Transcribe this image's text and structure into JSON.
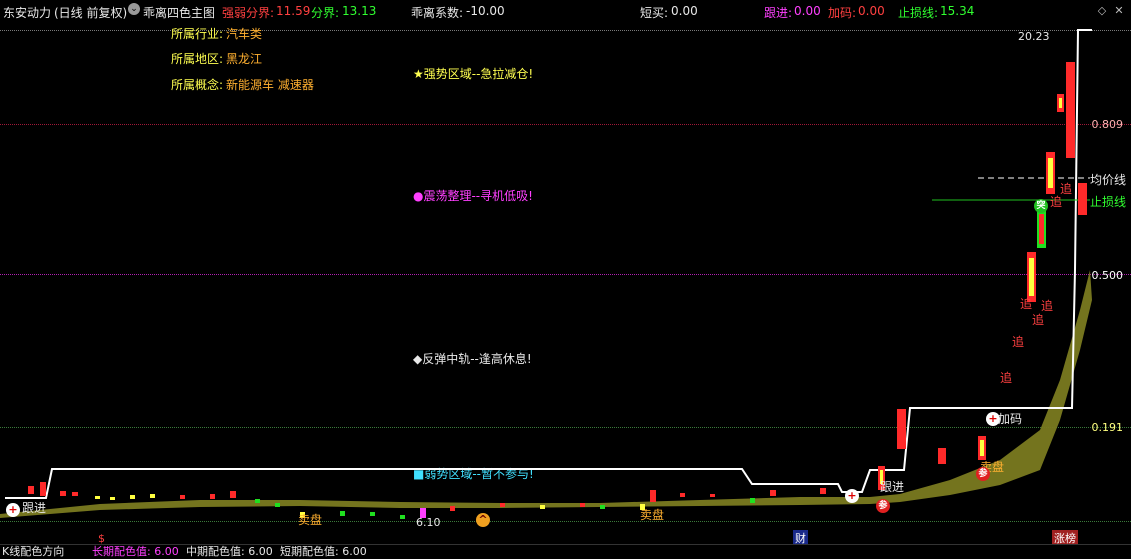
{
  "header": {
    "stock_name": "东安动力",
    "period": "(日线 前复权)",
    "indicator_name": "乖离四色主图",
    "strength_label": "强弱分界:",
    "strength_value": "11.59",
    "divide_label": "分界:",
    "divide_value": "13.13",
    "deviation_label": "乖离系数:",
    "deviation_value": "-10.00",
    "short_buy_label": "短买:",
    "short_buy_value": "0.00",
    "follow_label": "跟进:",
    "follow_value": "0.00",
    "add_label": "加码:",
    "add_value": "0.00",
    "stoploss_label": "止损线:",
    "stoploss_value": "15.34"
  },
  "info": {
    "industry_label": "所属行业:",
    "industry_value": "汽车类",
    "region_label": "所属地区:",
    "region_value": "黑龙江",
    "concept_label": "所属概念:",
    "concept_value": "新能源车 减速器"
  },
  "zones": {
    "strong": "★强势区域--急拉减仓!",
    "oscillate": "●震荡整理--寻机低吸!",
    "rebound": "◆反弹中轨--逢高休息!",
    "weak": "■弱势区域--暂不参与!"
  },
  "levels": {
    "top": "20.23",
    "l1": "0.809",
    "l2": "0.500",
    "l3": "0.191",
    "low": "6.10"
  },
  "lines": {
    "avg": "均价线",
    "stop": "止损线"
  },
  "markers": {
    "follow1": "跟进",
    "follow2": "跟进",
    "add": "加码",
    "sell": "卖盘",
    "sell2": "卖盘",
    "sell3": "卖盘",
    "chase": "追",
    "tu": "突",
    "can": "参",
    "plus": "+",
    "dollar": "$",
    "cai": "财",
    "zhangting": "涨榜"
  },
  "footer": {
    "label1": "K线配色方向",
    "label2": "长期配色值: 6.00",
    "label3": "中期配色值: 6.00",
    "label4": "短期配色值: 6.00"
  },
  "colors": {
    "bg": "#000000",
    "up": "#ff2a2a",
    "down": "#20e020",
    "band": "#7a7a20",
    "stopline": "#20c020"
  },
  "icons": {
    "indicator": "chevron-down-icon",
    "settings": "diamond-icon",
    "close": "close-icon"
  }
}
